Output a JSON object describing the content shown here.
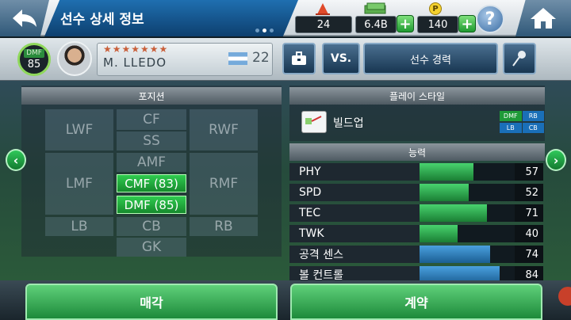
{
  "header": {
    "title": "선수 상세 정보"
  },
  "resources": {
    "cones": "24",
    "money": "6.4B",
    "points": "140",
    "points_icon": "P"
  },
  "icons": {
    "back": "back-arrow-icon",
    "help": "?",
    "home": "home-icon",
    "plus": "+"
  },
  "player": {
    "position": "DMF",
    "overall": "85",
    "name": "M. LLEDO",
    "stars": "★★★★★★★",
    "number": "22"
  },
  "buttons": {
    "vs": "VS.",
    "career": "선수 경력",
    "sell": "매각",
    "contract": "계약"
  },
  "positions": {
    "header": "포지션",
    "cells": {
      "lwf": "LWF",
      "cf": "CF",
      "rwf": "RWF",
      "ss": "SS",
      "amf": "AMF",
      "lmf": "LMF",
      "cmf": "CMF (83)",
      "rmf": "RMF",
      "dmf": "DMF (85)",
      "lb": "LB",
      "cb": "CB",
      "rb": "RB",
      "gk": "GK"
    }
  },
  "playstyle": {
    "header": "플레이 스타일",
    "name": "빌드업",
    "mini_positions": [
      "DMF",
      "RB",
      "LB",
      "CB"
    ]
  },
  "abilities": {
    "header": "능력",
    "rows": [
      {
        "label": "PHY",
        "value": "57",
        "fill": 0.57
      },
      {
        "label": "SPD",
        "value": "52",
        "fill": 0.52
      },
      {
        "label": "TEC",
        "value": "71",
        "fill": 0.71
      },
      {
        "label": "TWK",
        "value": "40",
        "fill": 0.4
      },
      {
        "label": "공격 센스",
        "value": "74",
        "fill": 0.74
      },
      {
        "label": "볼 컨트롤",
        "value": "84",
        "fill": 0.84
      }
    ]
  }
}
